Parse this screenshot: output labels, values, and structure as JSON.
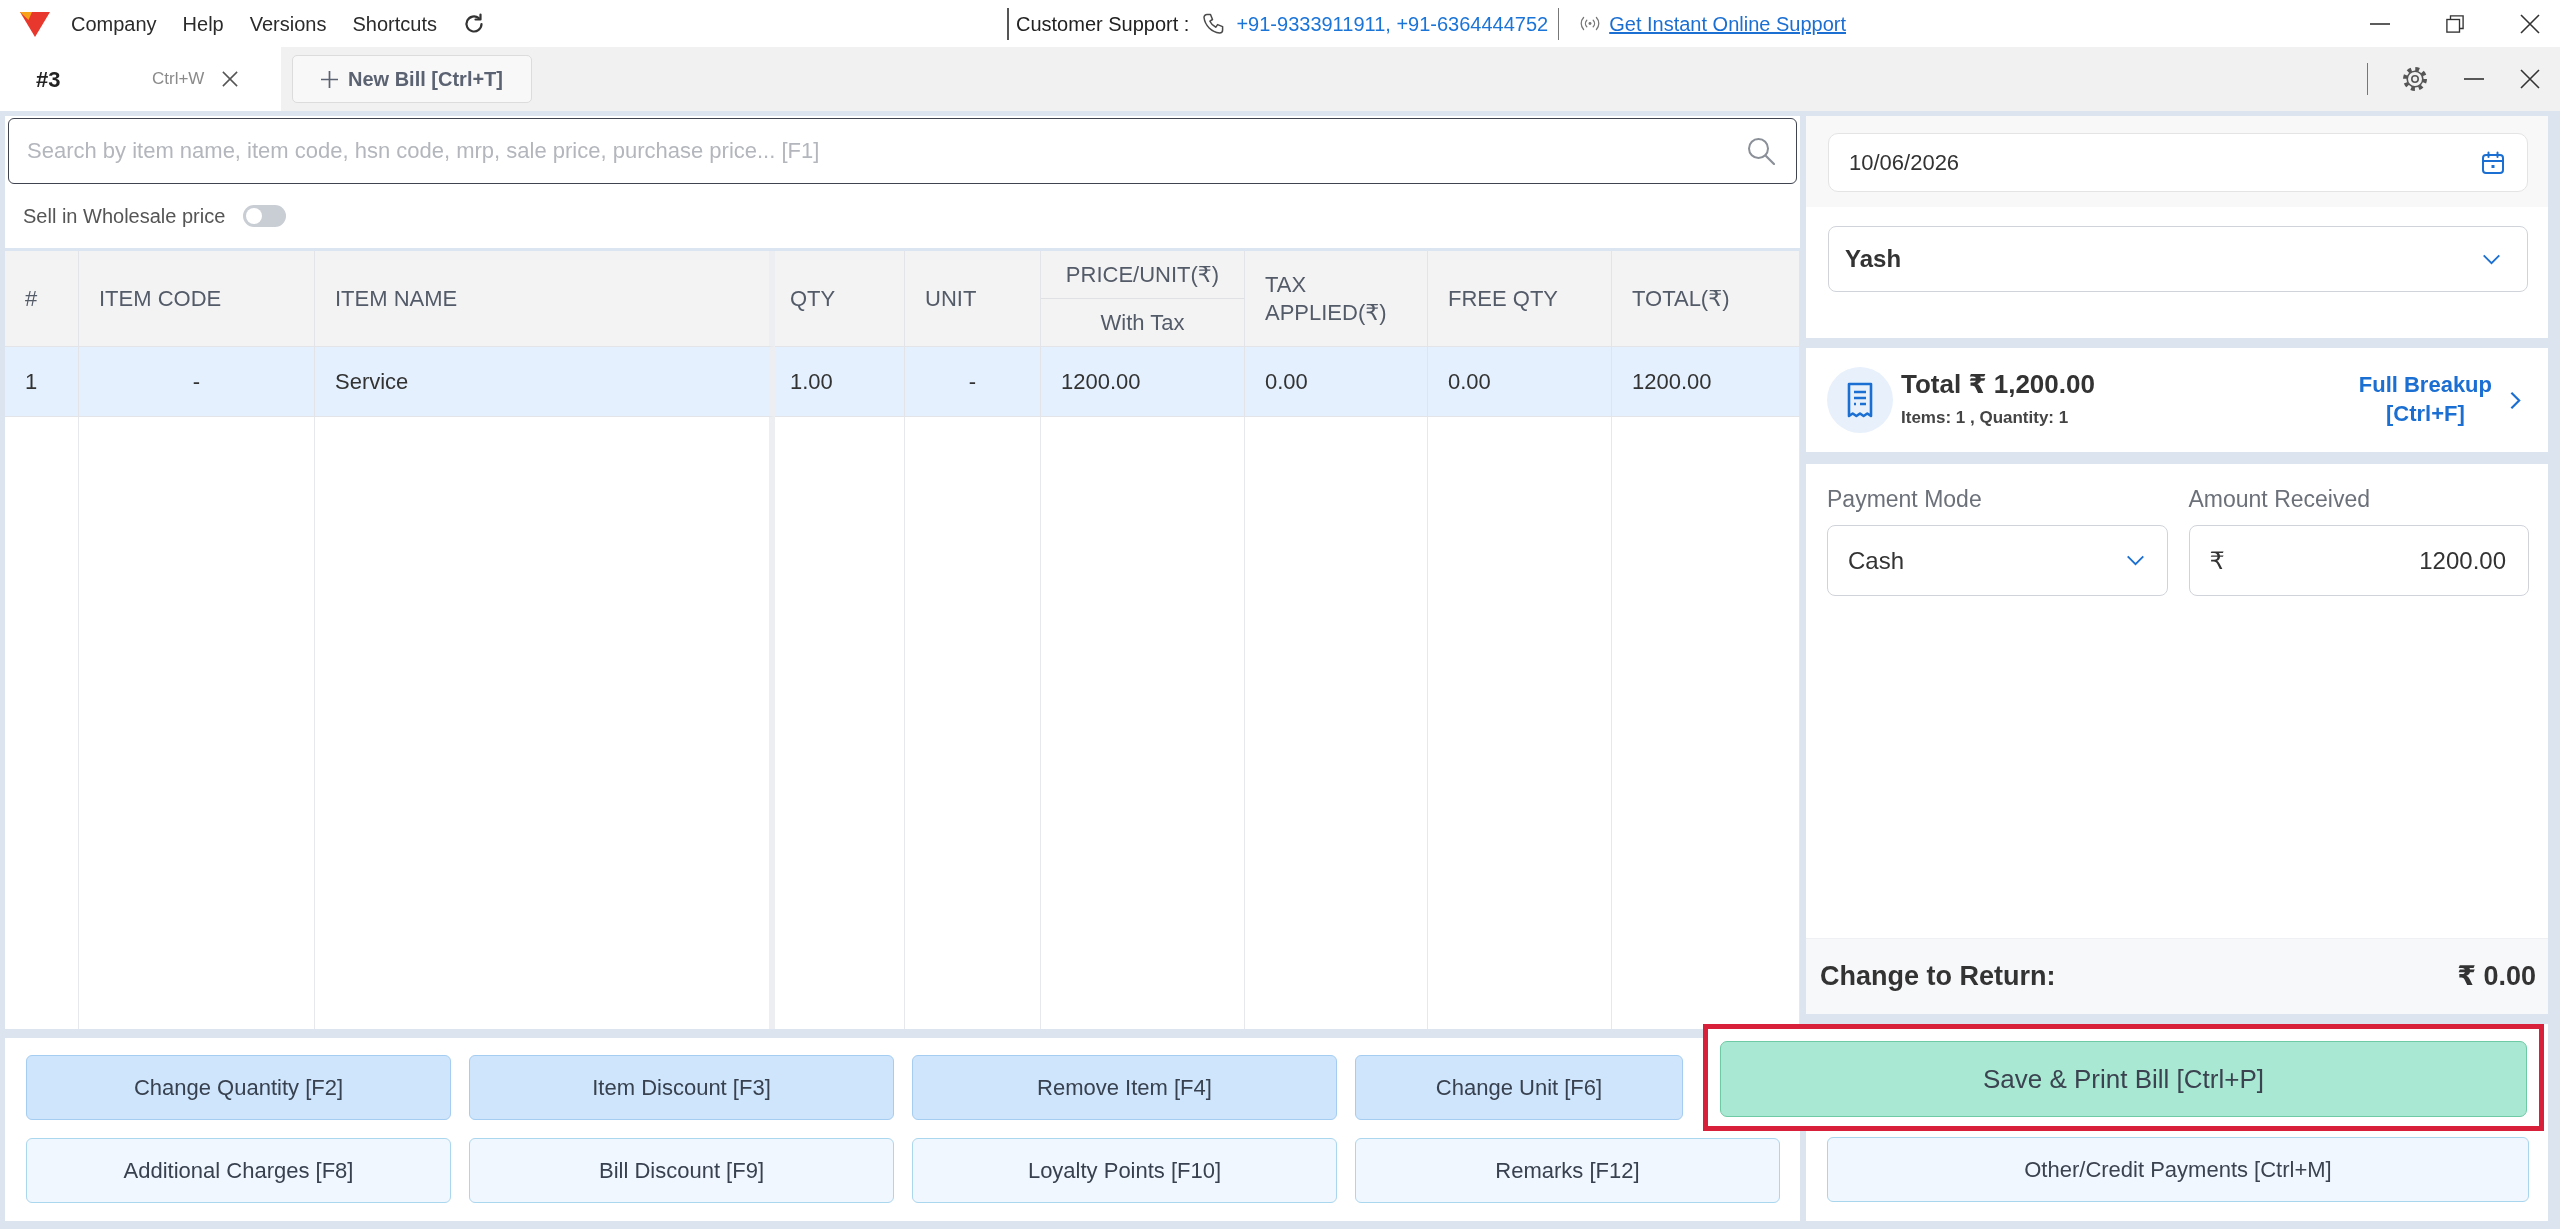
{
  "menu_bar": {
    "items": [
      "Company",
      "Help",
      "Versions",
      "Shortcuts"
    ],
    "support_label": "Customer Support :",
    "support_phones": "+91-9333911911, +91-6364444752",
    "support_link": "Get Instant Online Support"
  },
  "tabs": [
    {
      "label": "#3",
      "shortcut": "Ctrl+W",
      "selected": true
    }
  ],
  "new_bill_button": "New Bill [Ctrl+T]",
  "search": {
    "placeholder": "Search by item name, item code, hsn code, mrp, sale price, purchase price... [F1]"
  },
  "wholesale_toggle": {
    "label": "Sell in Wholesale price",
    "on": false
  },
  "table": {
    "columns": [
      {
        "label": "#"
      },
      {
        "label": "ITEM CODE"
      },
      {
        "label": "ITEM NAME"
      },
      {
        "label": "QTY"
      },
      {
        "label": "UNIT"
      },
      {
        "label": "PRICE/UNIT(₹)",
        "sublabel": "With Tax"
      },
      {
        "label": "TAX APPLIED(₹)"
      },
      {
        "label": "FREE QTY"
      },
      {
        "label": "TOTAL(₹)"
      }
    ],
    "rows": [
      {
        "cells": [
          "1",
          "-",
          "Service",
          "1.00",
          "-",
          "1200.00",
          "0.00",
          "0.00",
          "1200.00"
        ],
        "selected": true
      }
    ]
  },
  "actions": [
    {
      "label": "Change Quantity [F2]",
      "kind": "primary"
    },
    {
      "label": "Item Discount [F3]",
      "kind": "primary"
    },
    {
      "label": "Remove Item [F4]",
      "kind": "primary"
    },
    {
      "label": "Change Unit [F6]",
      "kind": "primary"
    },
    {
      "label": "Additional Charges [F8]",
      "kind": "secondary"
    },
    {
      "label": "Bill Discount [F9]",
      "kind": "secondary"
    },
    {
      "label": "Loyalty Points [F10]",
      "kind": "secondary"
    },
    {
      "label": "Remarks [F12]",
      "kind": "secondary"
    }
  ],
  "date_field": {
    "value": "10/06/2026"
  },
  "customer_select": {
    "value": "Yash"
  },
  "summary": {
    "total": "Total ₹ 1,200.00",
    "details": "Items: 1 , Quantity: 1",
    "breakup_link": [
      "Full Breakup",
      "[Ctrl+F]"
    ]
  },
  "payment": {
    "mode_label": "Payment Mode",
    "mode_value": "Cash",
    "amount_label": "Amount Received",
    "currency": "₹",
    "amount_value": "1200.00"
  },
  "change": {
    "label": "Change to Return:",
    "value": "₹ 0.00"
  },
  "save_button": {
    "label": "Save & Print Bill [Ctrl+P]",
    "highlighted": true
  },
  "other_payments_button": "Other/Credit Payments [Ctrl+M]"
}
